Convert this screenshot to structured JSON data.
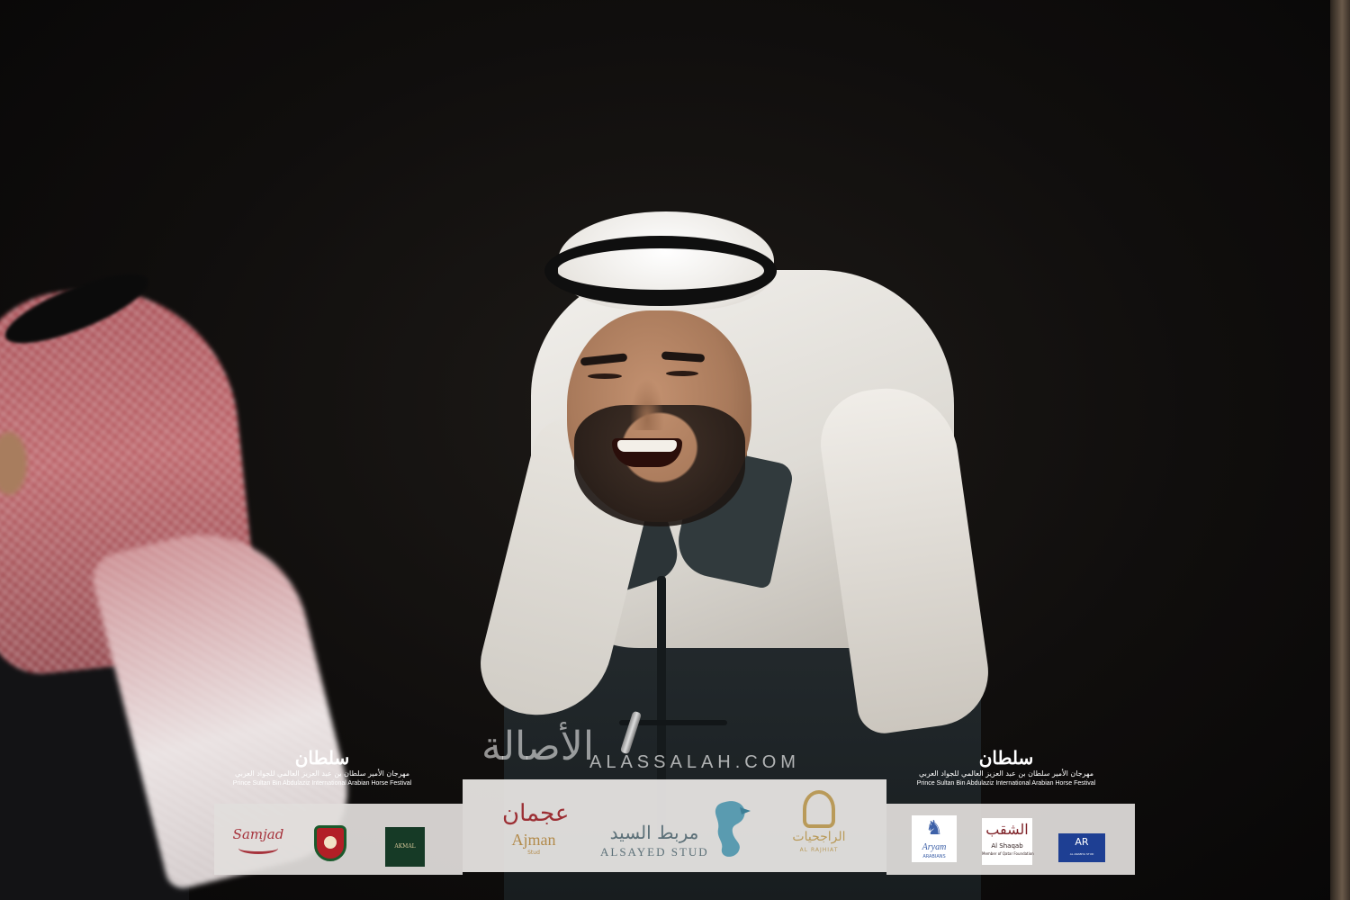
{
  "watermark": {
    "arabic": "الأصالة",
    "latin": "ALASSALAH.COM"
  },
  "festival_logo": {
    "emblem": "سلطان",
    "arabic": "مهرجان الأمير سلطان بن عبد العزيز العالمي للجواد العربي",
    "english": "Prince Sultan Bin Abdulaziz International Arabian Horse Festival"
  },
  "sponsors": {
    "samjad": {
      "text": "Samjad"
    },
    "crest": {
      "text": ""
    },
    "akmal": {
      "text": "AKMAL"
    },
    "ajman": {
      "arabic": "عجمان",
      "english": "Ajman",
      "sub": "Stud"
    },
    "alsayed": {
      "arabic": "مربط السيد",
      "english": "ALSAYED STUD"
    },
    "alrajhiat": {
      "arabic": "الراجحيات",
      "english": "AL RAJHIAT"
    },
    "aryam": {
      "english": "Aryam",
      "sub": "ARABIANS"
    },
    "alshaqab": {
      "arabic": "الشقب",
      "english": "Al Shaqab",
      "sub": "Member of Qatar Foundation"
    },
    "blue": {
      "mark": "AR",
      "sub": "AL ARABIYA STUD"
    }
  },
  "colors": {
    "background": "#0c0b0a",
    "ghutra": "#f2f0ec",
    "thobe": "#2a3134",
    "shemagh_red": "#a3454c",
    "banner": "#e1dedc"
  },
  "icons": {
    "festival": "chess-knight-calligraphy-icon",
    "seahorse": "seahorse-icon",
    "horse_head": "horse-head-icon"
  }
}
